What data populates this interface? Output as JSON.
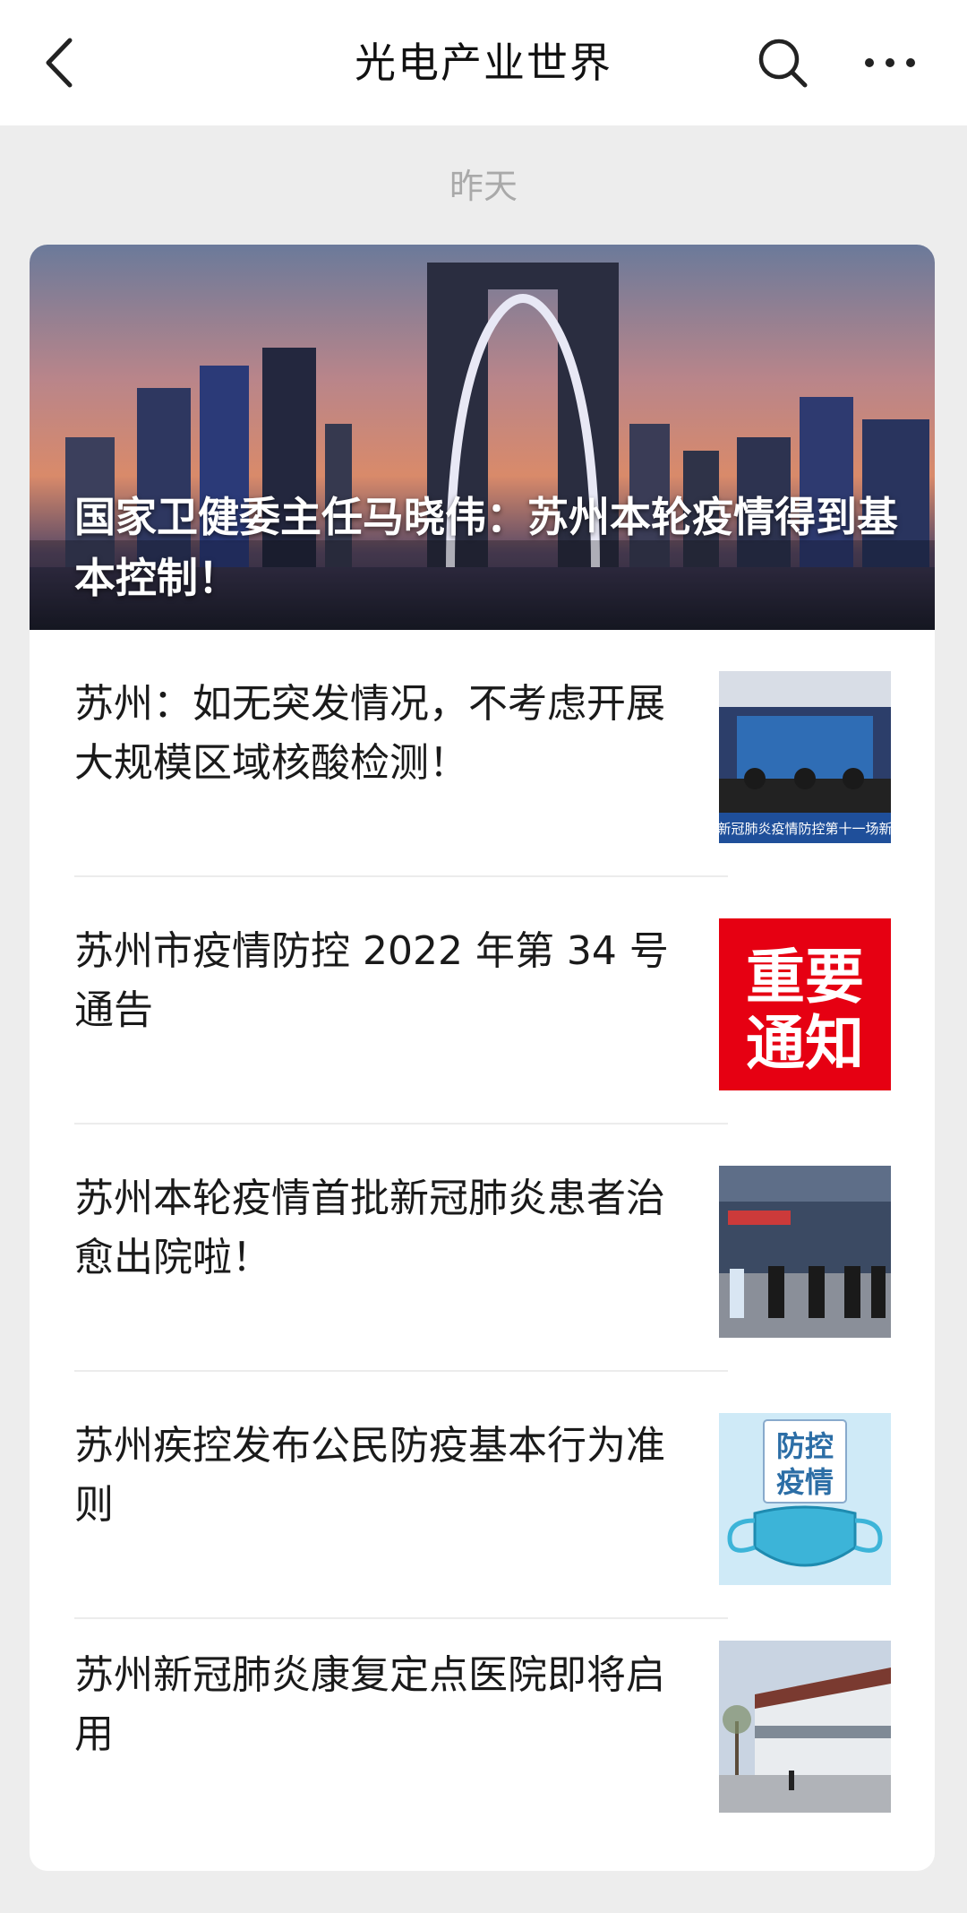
{
  "nav": {
    "title": "光电产业世界",
    "back_icon": "chevron-left-icon",
    "search_icon": "search-icon",
    "more_icon": "more-horizontal-icon"
  },
  "date_label": "昨天",
  "hero": {
    "title": "国家卫健委主任马晓伟：苏州本轮疫情得到基本控制！"
  },
  "articles": [
    {
      "title": "苏州：如无突发情况，不考虑开展大规模区域核酸检测！",
      "thumb_caption": "新冠肺炎疫情防控第十一场新"
    },
    {
      "title": "苏州市疫情防控 2022 年第 34 号通告",
      "thumb_text_line1": "重要",
      "thumb_text_line2": "通知"
    },
    {
      "title": "苏州本轮疫情首批新冠肺炎患者治愈出院啦！"
    },
    {
      "title": "苏州疾控发布公民防疫基本行为准则",
      "thumb_text_line1": "防控",
      "thumb_text_line2": "疫情"
    },
    {
      "title": "苏州新冠肺炎康复定点医院即将启用"
    }
  ],
  "colors": {
    "nav_bg": "#ffffff",
    "page_bg": "#ededed",
    "card_bg": "#ffffff",
    "notice_red": "#e60012"
  }
}
